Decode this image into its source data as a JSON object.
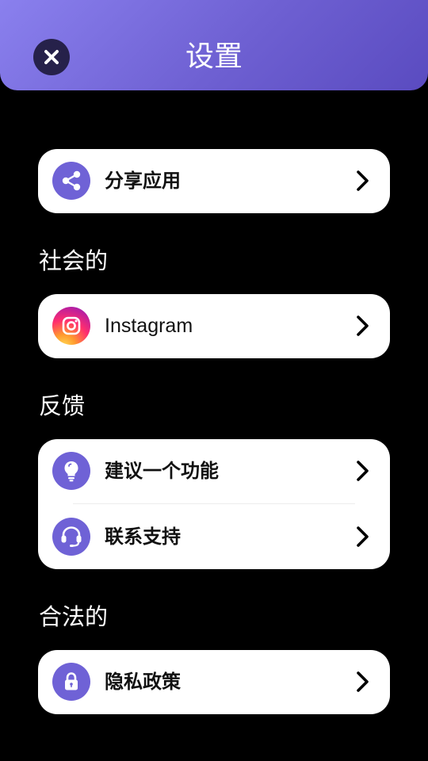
{
  "header": {
    "title": "设置",
    "close_icon": "close-icon"
  },
  "share_card": {
    "label": "分享应用",
    "icon": "share-icon"
  },
  "social": {
    "section_title": "社会的",
    "items": [
      {
        "label": "Instagram",
        "icon": "instagram-icon"
      }
    ]
  },
  "feedback": {
    "section_title": "反馈",
    "items": [
      {
        "label": "建议一个功能",
        "icon": "lightbulb-icon"
      },
      {
        "label": "联系支持",
        "icon": "headset-icon"
      }
    ]
  },
  "legal": {
    "section_title": "合法的",
    "items": [
      {
        "label": "隐私政策",
        "icon": "lock-icon"
      }
    ]
  },
  "colors": {
    "accent": "#6f62d6",
    "header_gradient_start": "#8a80ee",
    "header_gradient_end": "#5a4bc0",
    "background": "#000000",
    "card": "#ffffff"
  }
}
